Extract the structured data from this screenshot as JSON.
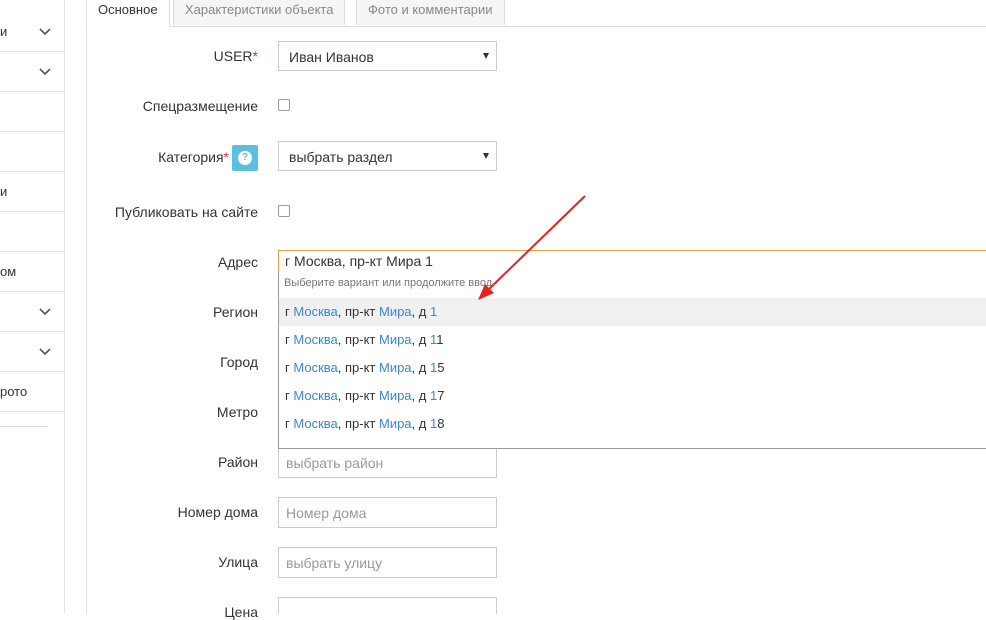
{
  "sidebar": {
    "items": [
      {
        "label": "и",
        "chevron": true
      },
      {
        "label": "",
        "chevron": true
      },
      {
        "label": "",
        "chevron": false
      },
      {
        "label": "",
        "chevron": false
      },
      {
        "label": "и",
        "chevron": false
      },
      {
        "label": "",
        "chevron": false
      },
      {
        "label": "ом",
        "chevron": false
      },
      {
        "label": "",
        "chevron": true
      },
      {
        "label": "",
        "chevron": true
      },
      {
        "label": "рото",
        "chevron": false
      }
    ]
  },
  "tabs": [
    {
      "label": "Основное",
      "active": true
    },
    {
      "label": "Характеристики объекта",
      "active": false
    },
    {
      "label": "Фото и комментарии",
      "active": false
    }
  ],
  "form": {
    "user_label": "USER",
    "user_value": "Иван Иванов",
    "special_label": "Спецразмещение",
    "category_label": "Категория",
    "category_value": "выбрать раздел",
    "publish_label": "Публиковать на сайте",
    "address_label": "Адрес",
    "address_value": "г Москва, пр-кт Мира 1",
    "region_label": "Регион",
    "city_label": "Город",
    "metro_label": "Метро",
    "district_label": "Район",
    "district_placeholder": "выбрать район",
    "house_label": "Номер дома",
    "house_placeholder": "Номер дома",
    "street_label": "Улица",
    "street_placeholder": "выбрать улицу",
    "price_label": "Цена",
    "required_mark": "*",
    "help_icon": "?"
  },
  "suggestions": {
    "hint": "Выберите вариант или продолжите ввод",
    "items": [
      {
        "p1": "г ",
        "city": "Москва",
        "p2": ", пр-кт ",
        "street": "Мира",
        "p3": ", д ",
        "num_hl": "1",
        "num_rest": ""
      },
      {
        "p1": "г ",
        "city": "Москва",
        "p2": ", пр-кт ",
        "street": "Мира",
        "p3": ", д ",
        "num_hl": "1",
        "num_rest": "1"
      },
      {
        "p1": "г ",
        "city": "Москва",
        "p2": ", пр-кт ",
        "street": "Мира",
        "p3": ", д ",
        "num_hl": "1",
        "num_rest": "5"
      },
      {
        "p1": "г ",
        "city": "Москва",
        "p2": ", пр-кт ",
        "street": "Мира",
        "p3": ", д ",
        "num_hl": "1",
        "num_rest": "7"
      },
      {
        "p1": "г ",
        "city": "Москва",
        "p2": ", пр-кт ",
        "street": "Мира",
        "p3": ", д ",
        "num_hl": "1",
        "num_rest": "8"
      }
    ]
  },
  "colors": {
    "highlight": "#3a87d6",
    "required": "#e03030",
    "annotation_arrow": "#e82020",
    "focus_border": "#f0a040"
  },
  "icons": {
    "chevron": "chevron-down-icon",
    "help": "help-icon",
    "annotation": "red-arrow-annotation"
  }
}
